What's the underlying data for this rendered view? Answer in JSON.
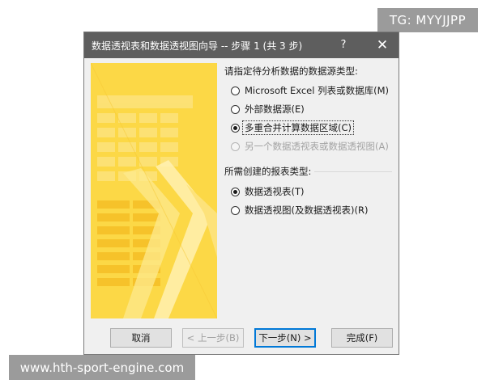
{
  "badge": {
    "text": "TG: MYYJJPP"
  },
  "watermark": {
    "text": "www.hth-sport-engine.com"
  },
  "dialog": {
    "title": "数据透视表和数据透视图向导 -- 步骤 1 (共 3 步)",
    "help": "?",
    "close": "✕",
    "source_heading": "请指定待分析数据的数据源类型:",
    "source_options": [
      {
        "label": "Microsoft Excel 列表或数据库(M)",
        "checked": false,
        "disabled": false
      },
      {
        "label": "外部数据源(E)",
        "checked": false,
        "disabled": false
      },
      {
        "label": "多重合并计算数据区域(C)",
        "checked": true,
        "disabled": false
      },
      {
        "label": "另一个数据透视表或数据透视图(A)",
        "checked": false,
        "disabled": true
      }
    ],
    "report_heading": "所需创建的报表类型:",
    "report_options": [
      {
        "label": "数据透视表(T)",
        "checked": true
      },
      {
        "label": "数据透视图(及数据透视表)(R)",
        "checked": false
      }
    ],
    "buttons": {
      "cancel": "取消",
      "back": "< 上一步(B)",
      "next": "下一步(N) >",
      "finish": "完成(F)"
    }
  },
  "colors": {
    "titlebar": "#5e5e5e",
    "art_yellow": "#fbd33a",
    "focus_blue": "#0078d7"
  }
}
